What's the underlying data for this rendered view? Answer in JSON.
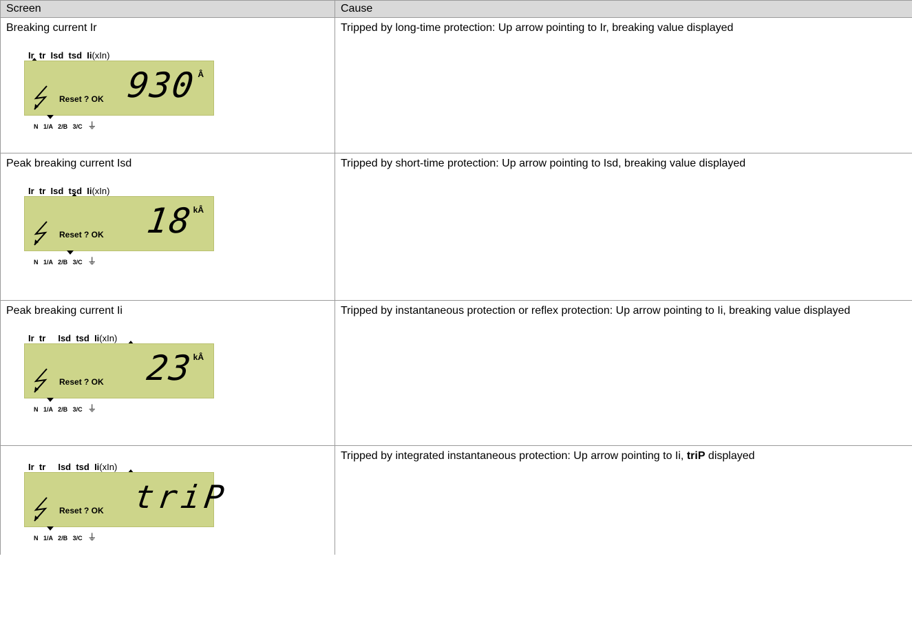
{
  "header": {
    "screen": "Screen",
    "cause": "Cause"
  },
  "lcd_common": {
    "top_labels": "Ir  tr  Isd  tsd  Ii",
    "top_suffix": "(xIn)",
    "reset": "Reset ? OK",
    "phases": "N   1/A   2/B   3/C",
    "ground_symbol": "⏚",
    "lcd_color": "#cdd58a"
  },
  "rows": [
    {
      "caption": "Breaking current Ir",
      "top_labels": "Ir  tr  Isd  tsd  Ii",
      "value": "930",
      "unit": "Â",
      "cause": "Tripped by long-time protection: Up arrow pointing to Ir, breaking value displayed"
    },
    {
      "caption": "Peak breaking current Isd",
      "top_labels": "Ir  tr  Isd  tsd  Ii",
      "value": "18",
      "unit": "kÂ",
      "cause": "Tripped by short-time protection: Up arrow pointing to Isd, breaking value displayed"
    },
    {
      "caption": "Peak breaking current Ii",
      "top_labels": "Ir  tr     Isd  tsd  Ii",
      "value": "23",
      "unit": "kÂ",
      "cause": "Tripped by instantaneous protection or reflex protection: Up arrow pointing to Ii, breaking value displayed"
    },
    {
      "caption": "",
      "top_labels": "Ir  tr     Isd  tsd  Ii",
      "value": "triP",
      "unit": "",
      "cause_prefix": "Tripped by integrated instantaneous protection: Up arrow pointing to Ii, ",
      "cause_bold": "triP",
      "cause_suffix": " displayed"
    }
  ]
}
